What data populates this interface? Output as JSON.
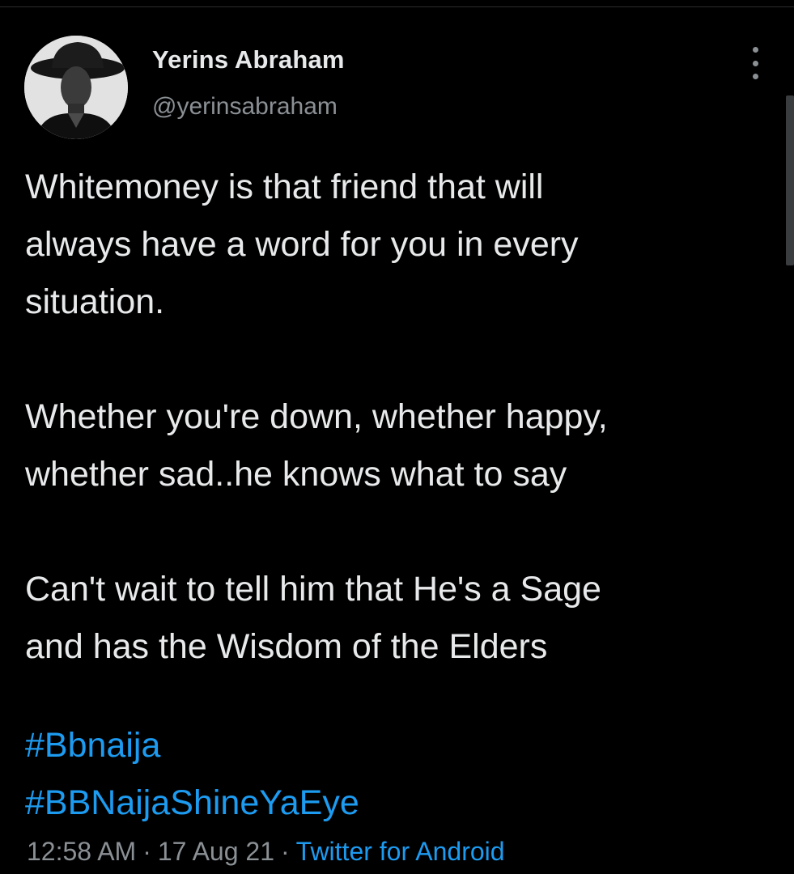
{
  "author": {
    "display_name": "Yerins Abraham",
    "handle": "@yerinsabraham",
    "avatar_icon": "profile-photo-man-in-hat"
  },
  "tweet": {
    "paragraphs": [
      [
        "Whitemoney is that friend that will",
        "always have a word for you in every",
        "situation."
      ],
      [
        "Whether you're down, whether happy,",
        "whether sad..he knows what to say"
      ],
      [
        "Can't wait to tell him that He's a Sage",
        "and has the Wisdom of the Elders"
      ]
    ],
    "hashtags": [
      "#Bbnaija",
      "#BBNaijaShineYaEye"
    ]
  },
  "meta": {
    "time": "12:58 AM",
    "separator": "·",
    "date": "17 Aug 21",
    "source": "Twitter for Android"
  },
  "colors": {
    "background": "#000000",
    "text": "#e7e9ea",
    "secondary_text": "#8b9095",
    "link": "#1d9bf0"
  },
  "icons": {
    "more": "more-vertical-icon"
  }
}
